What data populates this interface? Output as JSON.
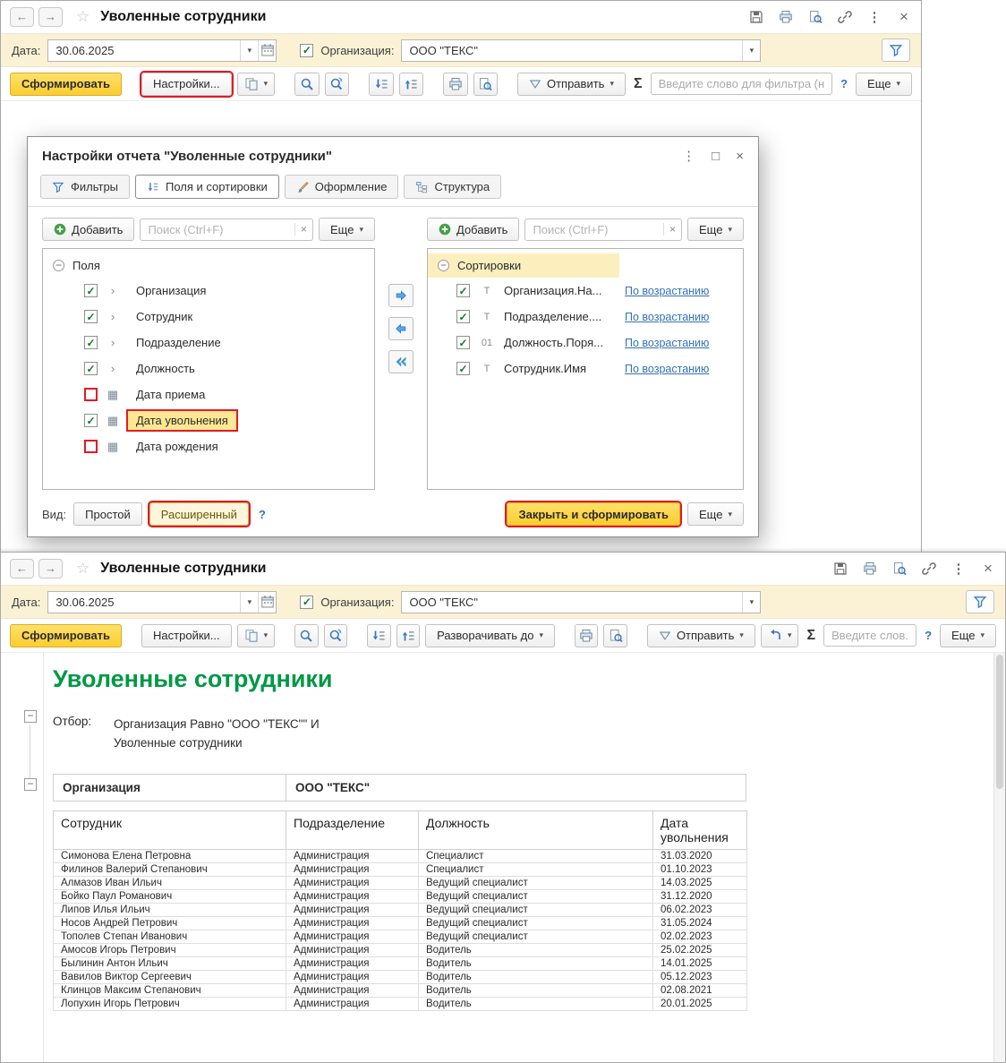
{
  "colors": {
    "accent_yellow": "#fbcd2e",
    "annotation_red": "#e01b24",
    "link_blue": "#3373b5",
    "report_title_green": "#009845",
    "filter_bar_bg": "#fbf2d6",
    "selection_yellow": "#ffe793"
  },
  "icons": {
    "back": "←",
    "forward": "→",
    "star": "☆",
    "kebab": "⋮",
    "close": "×",
    "maximize": "□",
    "caret": "▾",
    "collapse": "−",
    "check": "✓",
    "sum": "Σ",
    "search_clear": "×",
    "chevron": "›",
    "calendar_grid": "▦"
  },
  "top_form": {
    "title": "Уволенные сотрудники",
    "date_label": "Дата:",
    "date_value": "30.06.2025",
    "org_label": "Организация:",
    "org_value": "ООО \"ТЕКС\"",
    "generate": "Сформировать",
    "settings": "Настройки...",
    "send": "Отправить",
    "filter_placeholder": "Введите слово для фильтра (назва...",
    "help": "?",
    "more": "Еще"
  },
  "dialog": {
    "title": "Настройки отчета \"Уволенные сотрудники\"",
    "tabs": [
      "Фильтры",
      "Поля и сортировки",
      "Оформление",
      "Структура"
    ],
    "add": "Добавить",
    "search_placeholder": "Поиск (Ctrl+F)",
    "more": "Еще",
    "fields_root": "Поля",
    "fields": [
      {
        "label": "Организация",
        "checked": true,
        "kind": "group"
      },
      {
        "label": "Сотрудник",
        "checked": true,
        "kind": "group"
      },
      {
        "label": "Подразделение",
        "checked": true,
        "kind": "group"
      },
      {
        "label": "Должность",
        "checked": true,
        "kind": "group"
      },
      {
        "label": "Дата приема",
        "checked": false,
        "kind": "date",
        "checkbox_highlight": true
      },
      {
        "label": "Дата увольнения",
        "checked": true,
        "kind": "date",
        "selected": true
      },
      {
        "label": "Дата рождения",
        "checked": false,
        "kind": "date",
        "checkbox_highlight": true
      }
    ],
    "sorts_root": "Сортировки",
    "sorts": [
      {
        "label": "Организация.На...",
        "type": "T",
        "checked": true,
        "direction": "По возрастанию"
      },
      {
        "label": "Подразделение....",
        "type": "T",
        "checked": true,
        "direction": "По возрастанию"
      },
      {
        "label": "Должность.Поря...",
        "type": "01",
        "checked": true,
        "direction": "По возрастанию"
      },
      {
        "label": "Сотрудник.Имя",
        "type": "T",
        "checked": true,
        "direction": "По возрастанию"
      }
    ],
    "view_label": "Вид:",
    "view_simple": "Простой",
    "view_advanced": "Расширенный",
    "help": "?",
    "close_and_generate": "Закрыть и сформировать"
  },
  "bottom_form": {
    "title": "Уволенные сотрудники",
    "date_label": "Дата:",
    "date_value": "30.06.2025",
    "org_label": "Организация:",
    "org_value": "ООО \"ТЕКС\"",
    "generate": "Сформировать",
    "settings": "Настройки...",
    "expand_to": "Разворачивать до",
    "send": "Отправить",
    "filter_placeholder": "Введите слов...",
    "help": "?",
    "more": "Еще",
    "report": {
      "title": "Уволенные сотрудники",
      "selection_label": "Отбор:",
      "selection_lines": [
        "Организация Равно \"ООО \"ТЕКС\"\" И",
        "Уволенные сотрудники"
      ],
      "org_header": "Организация",
      "org_value": "ООО \"ТЕКС\"",
      "columns": [
        "Сотрудник",
        "Подразделение",
        "Должность",
        "Дата увольнения"
      ],
      "rows": [
        [
          "Симонова Елена Петровна",
          "Администрация",
          "Специалист",
          "31.03.2020"
        ],
        [
          "Филинов Валерий Степанович",
          "Администрация",
          "Специалист",
          "01.10.2023"
        ],
        [
          "Алмазов Иван Ильич",
          "Администрация",
          "Ведущий специалист",
          "14.03.2025"
        ],
        [
          "Бойко Паул Романович",
          "Администрация",
          "Ведущий специалист",
          "31.12.2020"
        ],
        [
          "Липов Илья Ильич",
          "Администрация",
          "Ведущий специалист",
          "06.02.2023"
        ],
        [
          "Носов Андрей Петрович",
          "Администрация",
          "Ведущий специалист",
          "31.05.2024"
        ],
        [
          "Тополев Степан Иванович",
          "Администрация",
          "Ведущий специалист",
          "02.02.2023"
        ],
        [
          "Амосов Игорь Петрович",
          "Администрация",
          "Водитель",
          "25.02.2025"
        ],
        [
          "Былинин Антон Ильич",
          "Администрация",
          "Водитель",
          "14.01.2025"
        ],
        [
          "Вавилов Виктор Сергеевич",
          "Администрация",
          "Водитель",
          "05.12.2023"
        ],
        [
          "Клинцов Максим Степанович",
          "Администрация",
          "Водитель",
          "02.08.2021"
        ],
        [
          "Лопухин Игорь Петрович",
          "Администрация",
          "Водитель",
          "20.01.2025"
        ]
      ]
    }
  }
}
